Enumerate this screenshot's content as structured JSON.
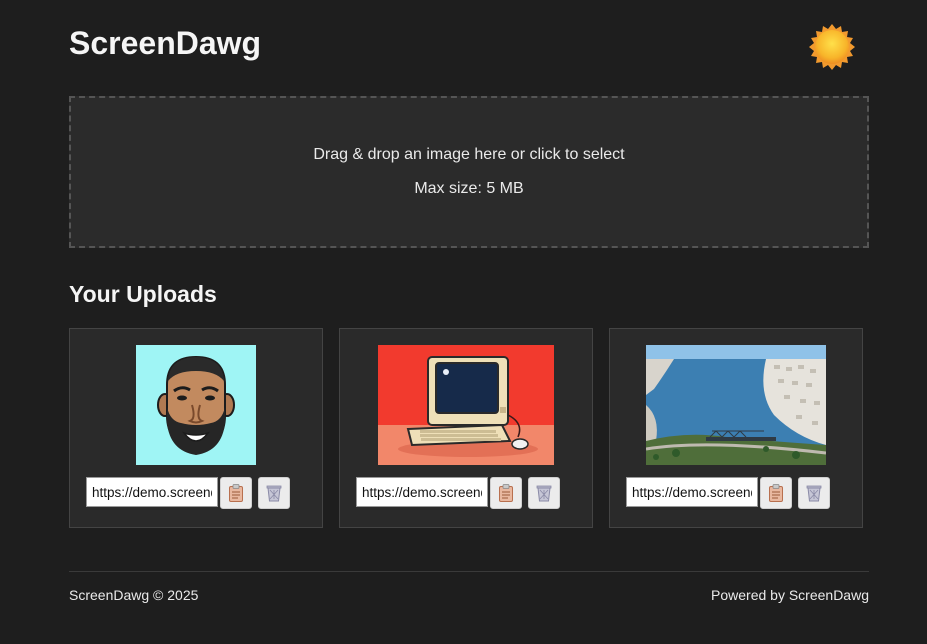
{
  "header": {
    "title": "ScreenDawg",
    "theme_icon": "sun-icon"
  },
  "dropzone": {
    "instruction": "Drag & drop an image here or click to select",
    "max_size": "Max size: 5 MB"
  },
  "uploads": {
    "heading": "Your Uploads",
    "items": [
      {
        "image": "bearded-man-avatar",
        "url": "https://demo.screendawg.com",
        "copy_icon": "clipboard-icon",
        "delete_icon": "trash-icon"
      },
      {
        "image": "retro-computer",
        "url": "https://demo.screendawg.com",
        "copy_icon": "clipboard-icon",
        "delete_icon": "trash-icon"
      },
      {
        "image": "coastal-city-aerial",
        "url": "https://demo.screendawg.com",
        "copy_icon": "clipboard-icon",
        "delete_icon": "trash-icon"
      }
    ]
  },
  "footer": {
    "copyright": "ScreenDawg © 2025",
    "powered_by": "Powered by ScreenDawg"
  },
  "colors": {
    "background": "#1e1e1e",
    "panel": "#2b2b2b",
    "text": "#f0f0f0",
    "sun": "#f5a623"
  }
}
